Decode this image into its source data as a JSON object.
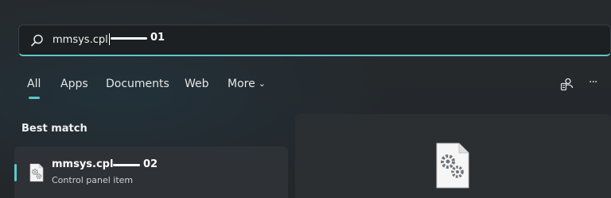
{
  "search": {
    "query": "mmsys.cpl",
    "annotation": "01"
  },
  "tabs": [
    {
      "label": "All",
      "active": true
    },
    {
      "label": "Apps"
    },
    {
      "label": "Documents"
    },
    {
      "label": "Web"
    },
    {
      "label": "More",
      "chevron": "chevron-down-icon"
    }
  ],
  "toolbar": {
    "icons": [
      "account-switch-icon",
      "more-options-icon"
    ],
    "more_label": "···"
  },
  "best_match": {
    "section_title": "Best match",
    "title": "mmsys.cpl",
    "subtitle": "Control panel item",
    "annotation": "02",
    "icon": "control-panel-gear-file-icon"
  },
  "colors": {
    "accent": "#5fc7c9",
    "background": "#23272a",
    "card": "#2e3236"
  }
}
